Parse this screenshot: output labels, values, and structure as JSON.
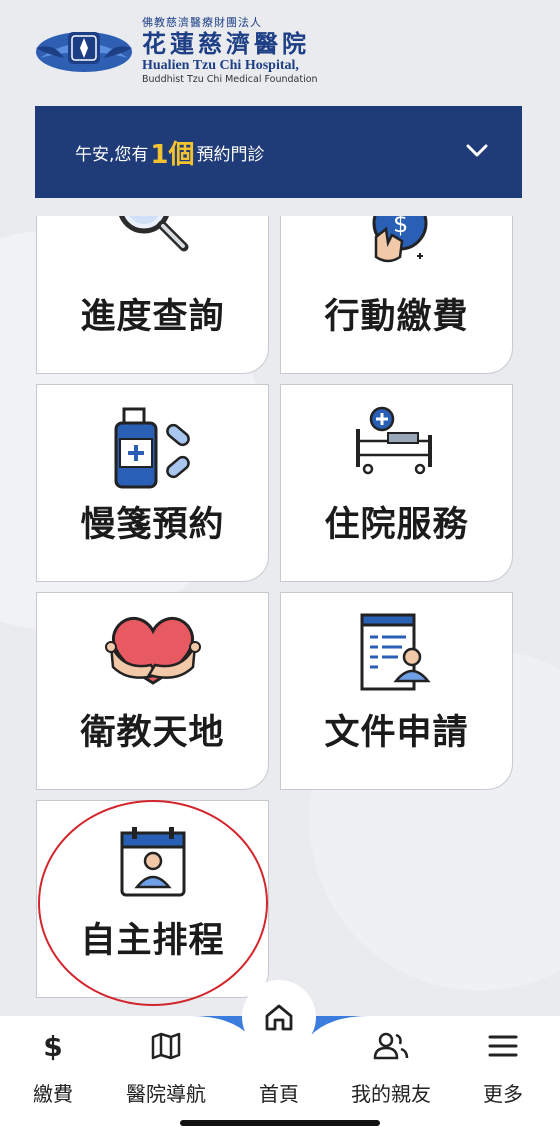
{
  "header": {
    "org_small": "佛教慈濟醫療財團法人",
    "hospital_cn": "花蓮慈濟醫院",
    "hospital_en": "Hualien Tzu Chi Hospital,",
    "foundation_en": "Buddhist Tzu Chi Medical Foundation"
  },
  "banner": {
    "greeting": "午安,您有",
    "count": "1個",
    "suffix": "預約門診",
    "expand_icon": "chevron-down-icon"
  },
  "tiles": [
    {
      "label": "進度查詢",
      "icon": "magnifier-icon"
    },
    {
      "label": "行動繳費",
      "icon": "coin-payment-icon"
    },
    {
      "label": "慢箋預約",
      "icon": "medicine-bottle-icon"
    },
    {
      "label": "住院服務",
      "icon": "hospital-bed-icon"
    },
    {
      "label": "衛教天地",
      "icon": "heart-hug-icon"
    },
    {
      "label": "文件申請",
      "icon": "clipboard-document-icon"
    },
    {
      "label": "自主排程",
      "icon": "calendar-person-icon"
    }
  ],
  "nav": {
    "items": [
      {
        "label": "繳費",
        "icon": "dollar-icon"
      },
      {
        "label": "醫院導航",
        "icon": "map-icon"
      },
      {
        "label": "首頁",
        "icon": "home-icon"
      },
      {
        "label": "我的親友",
        "icon": "people-icon"
      },
      {
        "label": "更多",
        "icon": "menu-icon"
      }
    ]
  },
  "colors": {
    "banner": "#1f3b78",
    "accent": "#f3c32f",
    "nav_arc": "#3b7ddd",
    "annotation": "#d3262c"
  }
}
